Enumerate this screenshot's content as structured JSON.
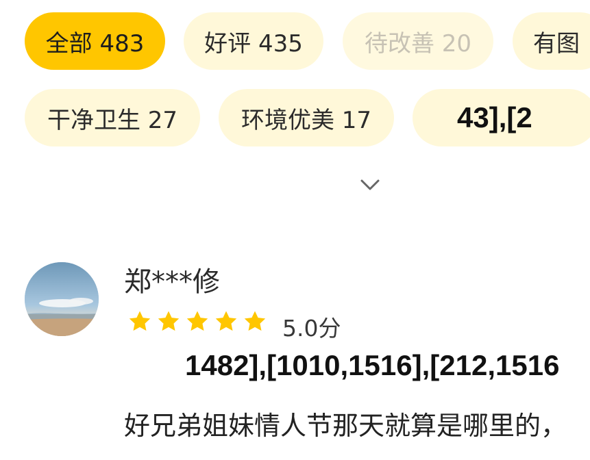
{
  "filters": {
    "row1": [
      {
        "label": "全部 483",
        "state": "active"
      },
      {
        "label": "好评 435",
        "state": "normal"
      },
      {
        "label": "待改善 20",
        "state": "disabled"
      },
      {
        "label": "有图",
        "state": "normal"
      }
    ],
    "row2": [
      {
        "label": "干净卫生 27",
        "state": "normal"
      },
      {
        "label": "环境优美 17",
        "state": "normal"
      },
      {
        "label": "43],[2",
        "state": "normal"
      }
    ],
    "expand_icon": "chevron-down-icon"
  },
  "review": {
    "avatar_icon": "avatar",
    "username": "郑***修",
    "rating_stars": 5,
    "score_text": "5.0分",
    "glitch_text": "1482],[1010,1516],[212,1516",
    "text": "好兄弟姐妹情人节那天就算是哪里的，"
  },
  "colors": {
    "active_chip": "#ffc600",
    "normal_chip": "#fff8d9",
    "disabled_text": "#c7c2b4",
    "star": "#ffc600"
  }
}
